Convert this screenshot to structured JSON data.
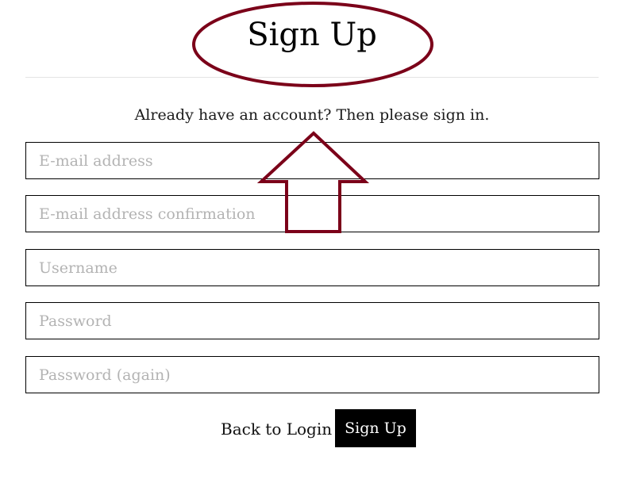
{
  "page": {
    "title": "Sign Up",
    "signin_prompt": "Already have an account? Then please sign in."
  },
  "form": {
    "fields": [
      {
        "name": "email",
        "placeholder": "E-mail address",
        "value": ""
      },
      {
        "name": "email2",
        "placeholder": "E-mail address confirmation",
        "value": ""
      },
      {
        "name": "username",
        "placeholder": "Username",
        "value": ""
      },
      {
        "name": "password",
        "placeholder": "Password",
        "value": ""
      },
      {
        "name": "password2",
        "placeholder": "Password (again)",
        "value": ""
      }
    ],
    "back_label": "Back to Login",
    "submit_label": "Sign Up"
  },
  "colors": {
    "annotation": "#7b0019",
    "button_bg": "#000000",
    "button_text": "#ffffff",
    "placeholder": "#b3b3b3"
  },
  "annotations": {
    "ellipse": "around page title",
    "arrow": "up-arrow pointing at sign-in prompt"
  }
}
